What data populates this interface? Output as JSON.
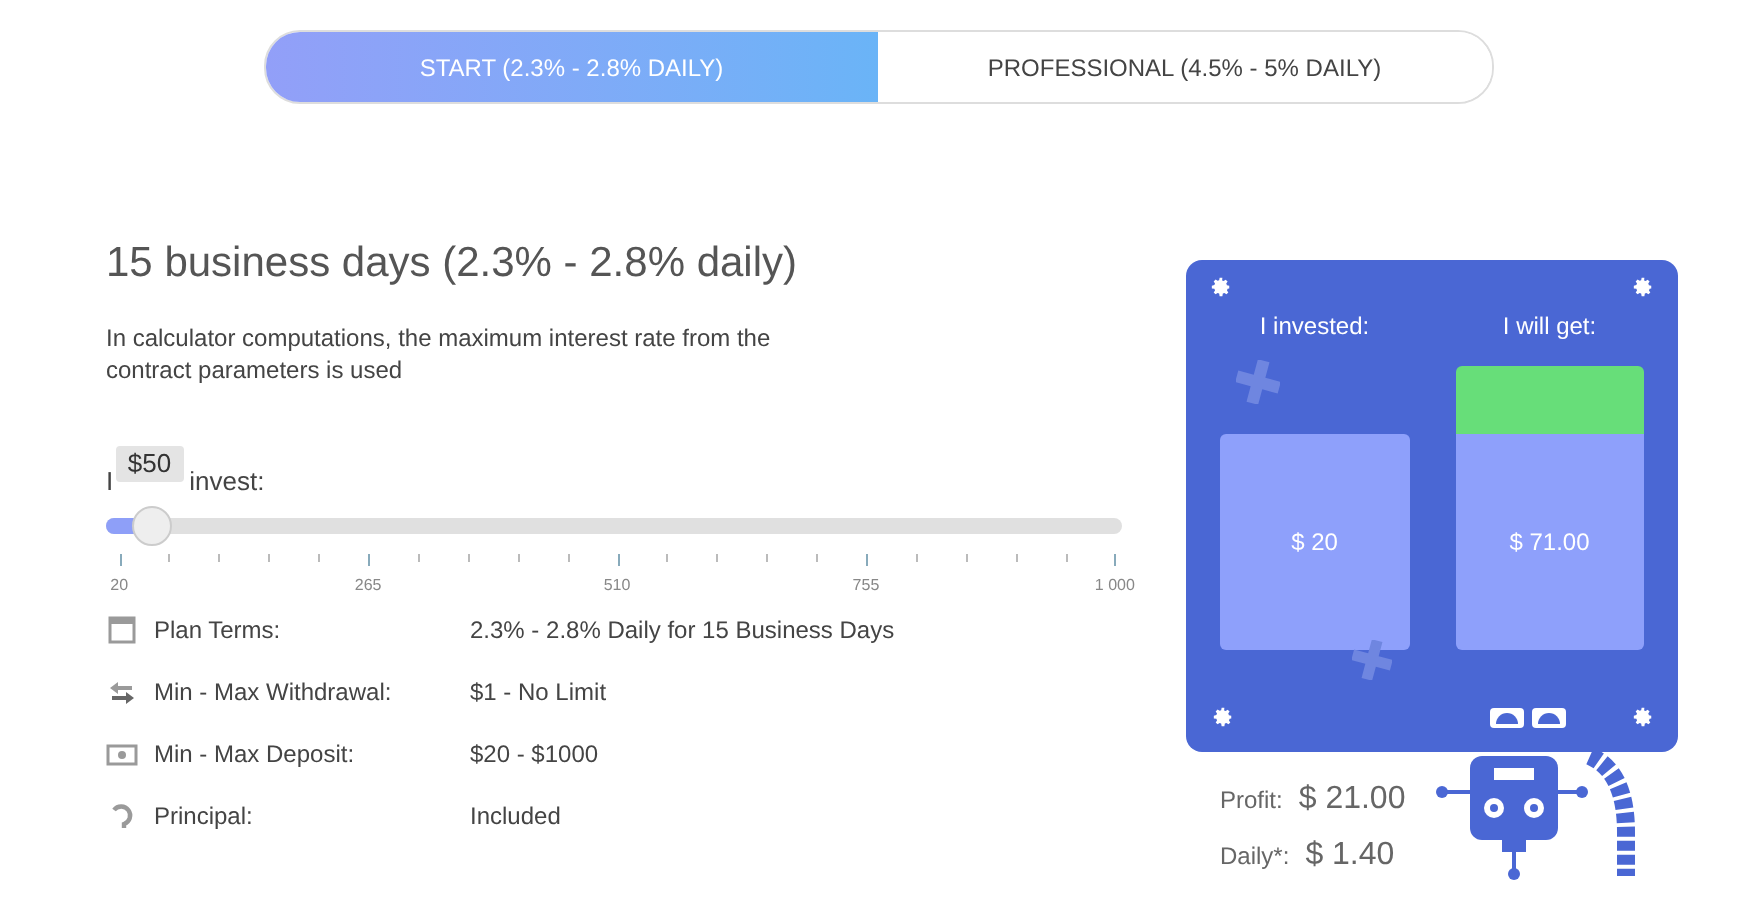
{
  "tabs": [
    {
      "label": "START (2.3% - 2.8% DAILY)",
      "selected": true
    },
    {
      "label": "PROFESSIONAL (4.5% - 5% DAILY)",
      "selected": false
    }
  ],
  "plan": {
    "title": "15 business days (2.3% - 2.8% daily)",
    "note": "In calculator computations, the maximum interest rate from the contract parameters is used"
  },
  "slider": {
    "label_start": "I",
    "label_end": "invest:",
    "tooltip": "$50",
    "level": 0.045,
    "tick_labels": [
      "20",
      "265",
      "510",
      "755",
      "1 000"
    ]
  },
  "terms": [
    {
      "kind": "calendar",
      "label": "Plan Terms:",
      "value": "2.3% - 2.8% Daily for 15 Business Days"
    },
    {
      "kind": "transfer",
      "label": "Min - Max Withdrawal:",
      "value": "$1 - No Limit"
    },
    {
      "kind": "cash",
      "label": "Min - Max Deposit:",
      "value": "$20 - $1000"
    },
    {
      "kind": "return",
      "label": "Principal:",
      "value": "Included"
    }
  ],
  "calculator": {
    "invested_label": "I invested:",
    "invested_value": "$ 20",
    "get_label": "I will get:",
    "get_value": "$ 71.00",
    "profit_label": "Profit:",
    "profit_value": "$ 21.00",
    "daily_label": "Daily*:",
    "daily_value": "$ 1.40"
  }
}
